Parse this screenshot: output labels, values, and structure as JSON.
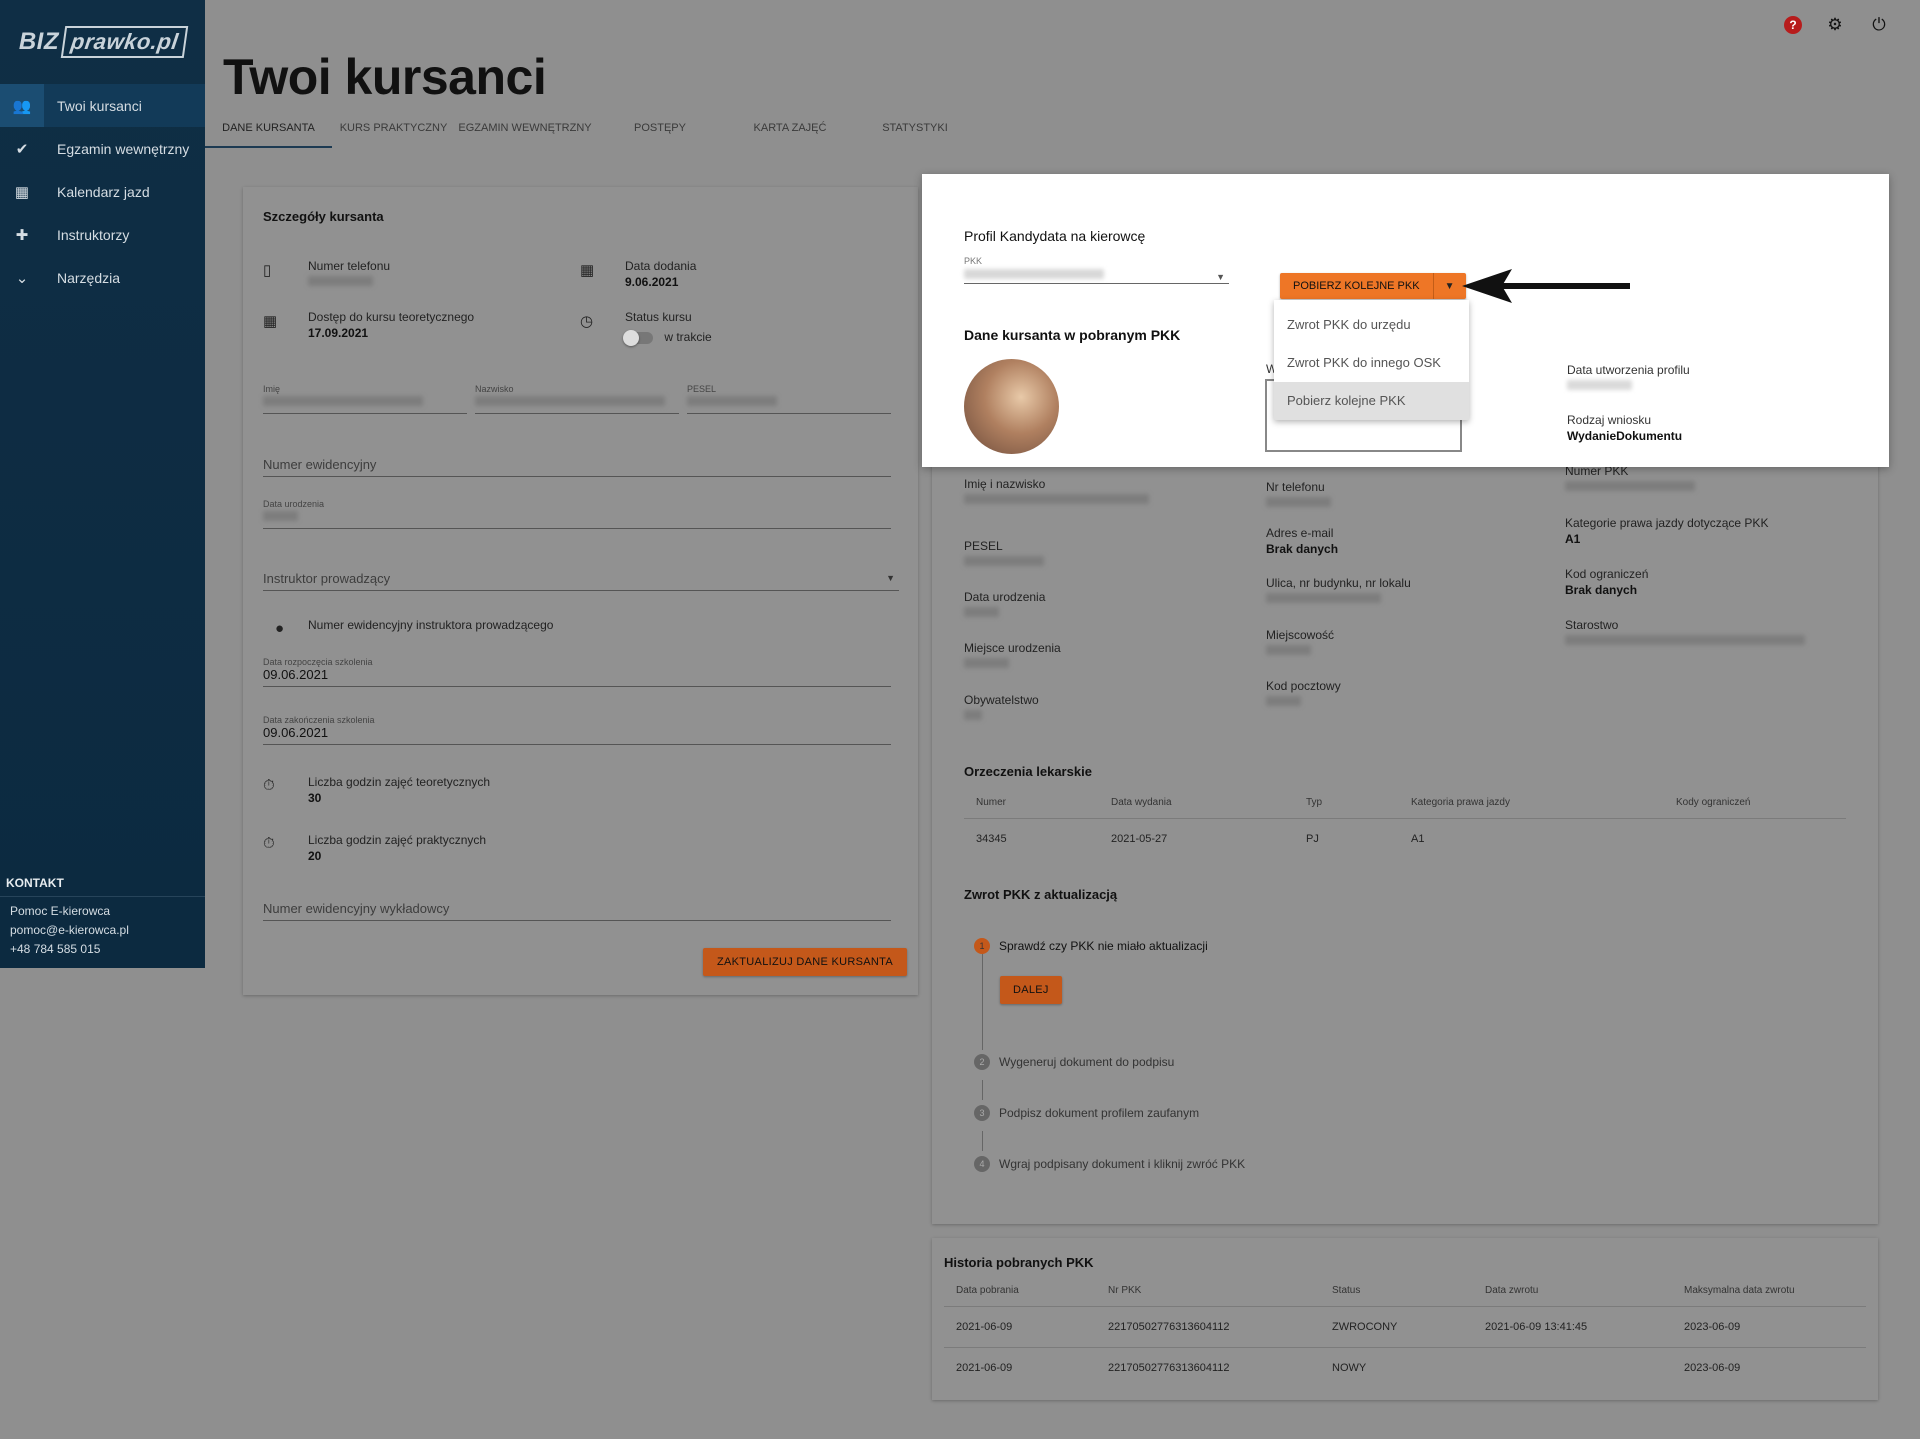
{
  "app": {
    "logo_left": "BIZ",
    "logo_right": "prawko.pl",
    "page_title": "Twoi kursanci"
  },
  "sidebar": {
    "items": [
      {
        "label": "Twoi kursanci",
        "icon": "people-icon"
      },
      {
        "label": "Egzamin wewnętrzny",
        "icon": "person-check-icon"
      },
      {
        "label": "Kalendarz jazd",
        "icon": "calendar-icon"
      },
      {
        "label": "Instruktorzy",
        "icon": "group-add-icon"
      },
      {
        "label": "Narzędzia",
        "icon": "chevron-down-icon"
      }
    ],
    "kontakt_title": "KONTAKT",
    "kontakt_lines": [
      "Pomoc E-kierowca",
      "pomoc@e-kierowca.pl",
      "+48 784 585 015"
    ]
  },
  "tabs": [
    "DANE KURSANTA",
    "KURS PRAKTYCZNY",
    "EGZAMIN WEWNĘTRZNY",
    "POSTĘPY",
    "KARTA ZAJĘĆ",
    "STATYSTYKI"
  ],
  "student": {
    "title": "Szczegóły kursanta",
    "phone_label": "Numer telefonu",
    "added_label": "Data dodania",
    "added_value": "9.06.2021",
    "theory_label": "Dostęp do kursu teoretycznego",
    "theory_value": "17.09.2021",
    "status_label": "Status kursu",
    "status_value": "w trakcie",
    "imie_label": "Imię",
    "nazwisko_label": "Nazwisko",
    "pesel_label": "PESEL",
    "nr_ewid_placeholder": "Numer ewidencyjny",
    "dob_label": "Data urodzenia",
    "instruktor_placeholder": "Instruktor prowadzący",
    "instruktor_nr_label": "Numer ewidencyjny instruktora prowadzącego",
    "start_label": "Data rozpoczęcia szkolenia",
    "start_value": "09.06.2021",
    "end_label": "Data zakończenia szkolenia",
    "end_value": "09.06.2021",
    "theory_hours_label": "Liczba godzin zajęć teoretycznych",
    "theory_hours_value": "30",
    "practice_hours_label": "Liczba godzin zajęć praktycznych",
    "practice_hours_value": "20",
    "lecturer_placeholder": "Numer ewidencyjny wykładowcy",
    "update_button": "ZAKTUALIZUJ DANE KURSANTA"
  },
  "pkk": {
    "title": "Profil Kandydata na kierowcę",
    "select_label": "PKK",
    "split_button": "POBIERZ KOLEJNE PKK",
    "menu": [
      "Zwrot PKK do urzędu",
      "Zwrot PKK do innego OSK",
      "Pobierz kolejne PKK"
    ],
    "data_title": "Dane kursanta w pobranym PKK",
    "partial_label": "W",
    "created_label": "Data utworzenia profilu",
    "request_type_label": "Rodzaj wniosku",
    "request_type_value": "WydanieDokumentu",
    "name_label": "Imię i nazwisko",
    "phone_label": "Nr telefonu",
    "pkk_number_label": "Numer PKK",
    "pesel_label": "PESEL",
    "email_label": "Adres e-mail",
    "email_value": "Brak danych",
    "categories_label": "Kategorie prawa jazdy dotyczące PKK",
    "categories_value": "A1",
    "dob_label": "Data urodzenia",
    "street_label": "Ulica, nr budynku, nr lokalu",
    "restriction_label": "Kod ograniczeń",
    "restriction_value": "Brak danych",
    "birthplace_label": "Miejsce urodzenia",
    "city_label": "Miejscowość",
    "starostwo_label": "Starostwo",
    "citizenship_label": "Obywatelstwo",
    "postal_label": "Kod pocztowy"
  },
  "medical": {
    "title": "Orzeczenia lekarskie",
    "columns": [
      "Numer",
      "Data wydania",
      "Typ",
      "Kategoria prawa jazdy",
      "Kody ograniczeń"
    ],
    "rows": [
      [
        "34345",
        "2021-05-27",
        "PJ",
        "A1",
        ""
      ]
    ]
  },
  "return": {
    "title": "Zwrot PKK z aktualizacją",
    "steps": [
      "Sprawdź czy PKK nie miało aktualizacji",
      "Wygeneruj dokument do podpisu",
      "Podpisz dokument profilem zaufanym",
      "Wgraj podpisany dokument i kliknij zwróć PKK"
    ],
    "next_button": "DALEJ"
  },
  "history": {
    "title": "Historia pobranych PKK",
    "columns": [
      "Data pobrania",
      "Nr PKK",
      "Status",
      "Data zwrotu",
      "Maksymalna data zwrotu"
    ],
    "rows": [
      [
        "2021-06-09",
        "22170502776313604112",
        "ZWROCONY",
        "2021-06-09 13:41:45",
        "2023-06-09"
      ],
      [
        "2021-06-09",
        "22170502776313604112",
        "NOWY",
        "",
        "2023-06-09"
      ]
    ]
  },
  "colors": {
    "sidebar": "#0f2e45",
    "accent_orange": "#ee7626",
    "overlay": "#8f8f8f"
  }
}
